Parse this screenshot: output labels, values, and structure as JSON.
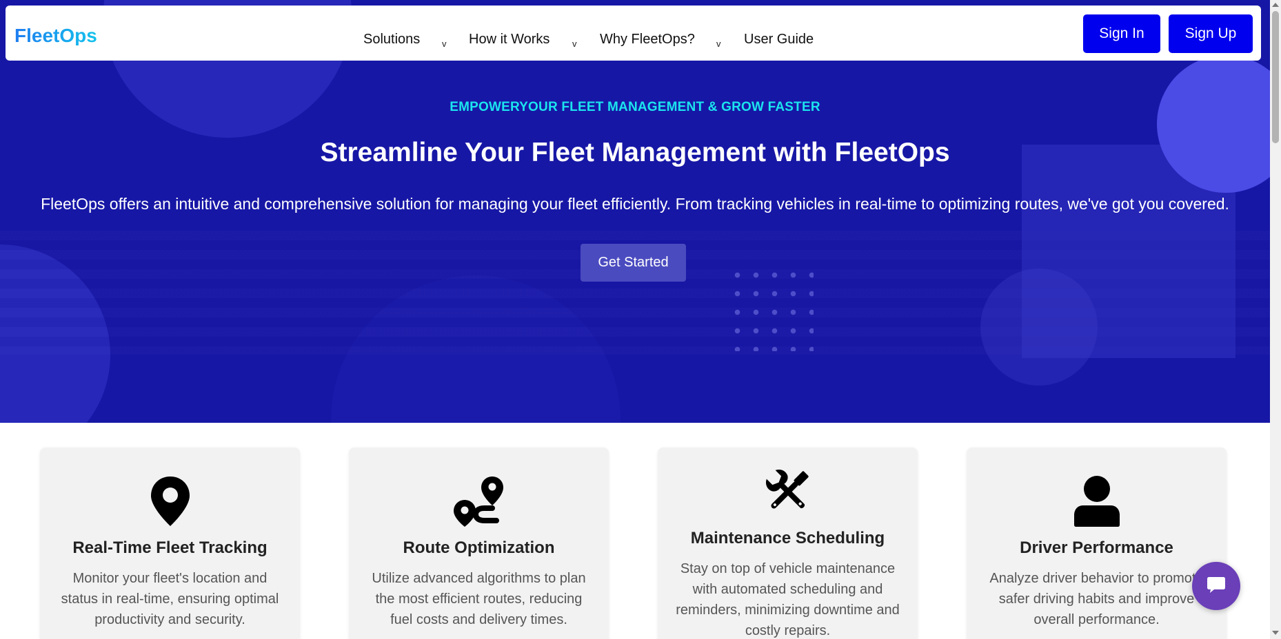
{
  "brand": {
    "name": "FleetOps"
  },
  "nav": {
    "items": [
      {
        "label": "Solutions",
        "has_dropdown": true
      },
      {
        "label": "How it Works",
        "has_dropdown": true
      },
      {
        "label": "Why FleetOps?",
        "has_dropdown": true
      },
      {
        "label": "User Guide",
        "has_dropdown": false
      }
    ],
    "dropdown_glyph": "v",
    "sign_in": "Sign In",
    "sign_up": "Sign Up"
  },
  "hero": {
    "eyebrow": "EMPOWERYOUR FLEET MANAGEMENT & GROW FASTER",
    "title": "Streamline Your Fleet Management with FleetOps",
    "subtitle": "FleetOps offers an intuitive and comprehensive solution for managing your fleet efficiently. From tracking vehicles in real-time to optimizing routes, we've got you covered.",
    "cta": "Get Started"
  },
  "features": [
    {
      "icon": "map-pin-icon",
      "title": "Real-Time Fleet Tracking",
      "lines": [
        "Monitor your fleet's location and",
        "status in real-time, ensuring optimal",
        "productivity and security."
      ]
    },
    {
      "icon": "route-icon",
      "title": "Route Optimization",
      "lines": [
        "Utilize advanced algorithms to plan",
        "the most efficient routes, reducing",
        "fuel costs and delivery times."
      ]
    },
    {
      "icon": "tools-icon",
      "title": "Maintenance Scheduling",
      "lines": [
        "Stay on top of vehicle maintenance",
        "with automated scheduling and",
        "reminders, minimizing downtime and",
        "costly repairs."
      ]
    },
    {
      "icon": "user-icon",
      "title": "Driver Performance",
      "lines": [
        "Analyze driver behavior to promote",
        "safer driving habits and improve",
        "overall performance."
      ]
    }
  ],
  "colors": {
    "hero_bg": "#1717a6",
    "accent": "#1be4ee",
    "auth_button": "#0000ee",
    "cta_button": "#4b4bc0",
    "chat_button": "#6a3fb8"
  },
  "chat": {
    "icon": "chat-bubble-icon"
  }
}
